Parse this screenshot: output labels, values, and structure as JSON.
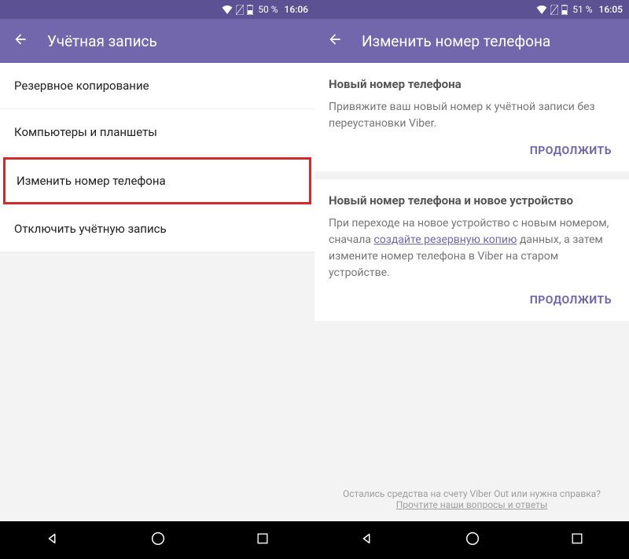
{
  "left": {
    "status": {
      "battery": "50 %",
      "time": "16:06"
    },
    "title": "Учётная запись",
    "items": [
      {
        "label": "Резервное копирование"
      },
      {
        "label": "Компьютеры и планшеты"
      },
      {
        "label": "Изменить номер телефона"
      },
      {
        "label": "Отключить учётную запись"
      }
    ]
  },
  "right": {
    "status": {
      "battery": "51 %",
      "time": "16:05"
    },
    "title": "Изменить номер телефона",
    "card1": {
      "title": "Новый номер телефона",
      "body": "Привяжите ваш новый номер к учётной записи без переустановки Viber.",
      "action": "ПРОДОЛЖИТЬ"
    },
    "card2": {
      "title": "Новый номер телефона и новое устройство",
      "body_pre": "При переходе на новое устройство с новым номером, сначала ",
      "body_link": "создайте резервную копию",
      "body_post": " данных, а затем измените номер телефона в Viber на старом устройстве.",
      "action": "ПРОДОЛЖИТЬ"
    },
    "footer": {
      "line1": "Остались средства на счету Viber Out или нужна справка?",
      "line2": "Прочтите наши вопросы и ответы"
    }
  }
}
